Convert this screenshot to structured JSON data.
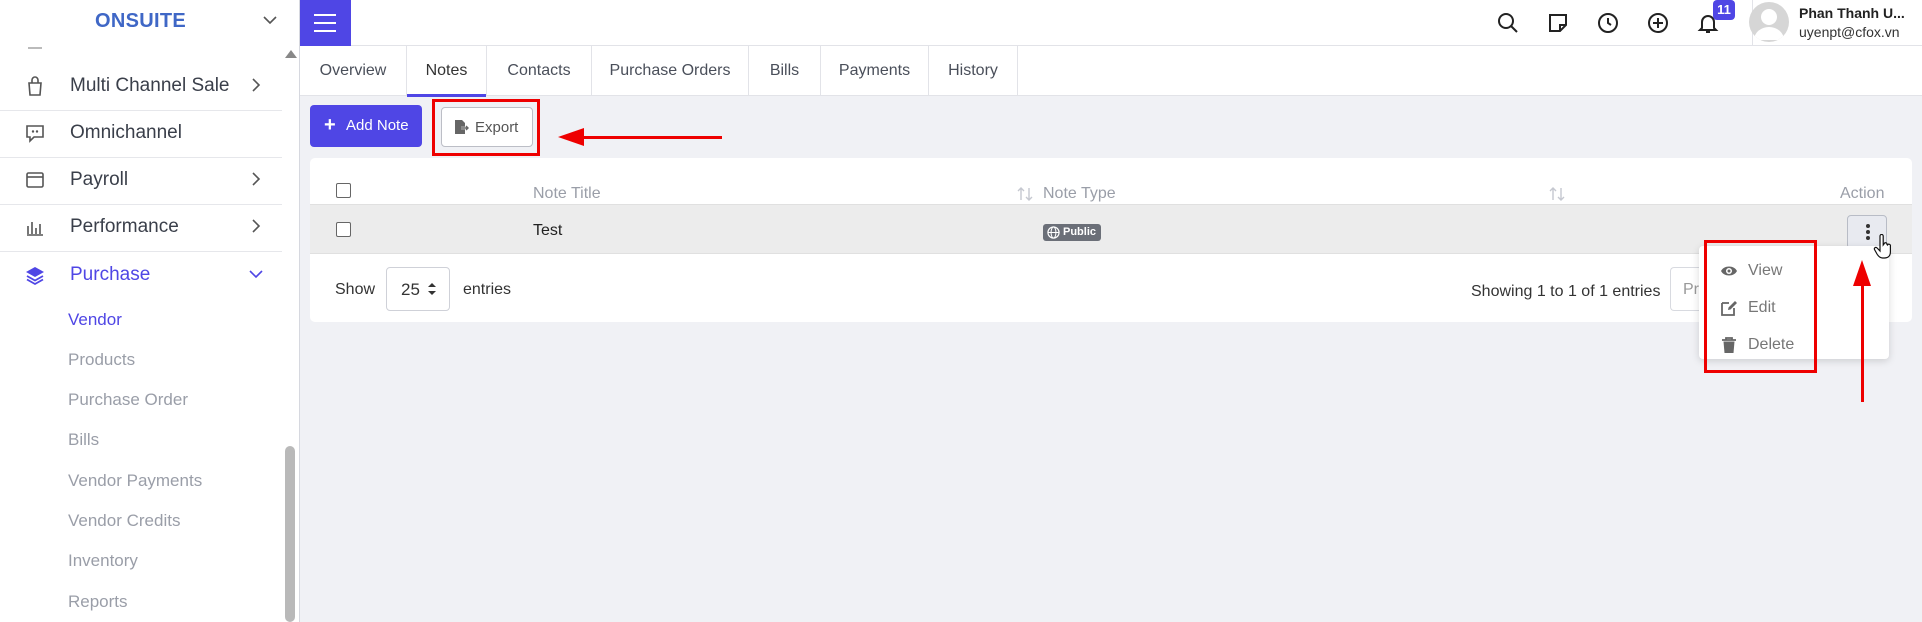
{
  "sidebar": {
    "brand": "ONSUITE",
    "items": [
      {
        "label": "Multi Channel Sale",
        "icon": "bag-icon",
        "has_chevron": true
      },
      {
        "label": "Omnichannel",
        "icon": "chat-icon",
        "has_chevron": false
      },
      {
        "label": "Payroll",
        "icon": "wallet-icon",
        "has_chevron": true
      },
      {
        "label": "Performance",
        "icon": "bar-chart-icon",
        "has_chevron": true
      },
      {
        "label": "Purchase",
        "icon": "layers-icon",
        "has_chevron": true,
        "expanded": true
      }
    ],
    "sub_items": [
      "Vendor",
      "Products",
      "Purchase Order",
      "Bills",
      "Vendor Payments",
      "Vendor Credits",
      "Inventory",
      "Reports"
    ],
    "active_sub_item": "Vendor"
  },
  "topbar": {
    "icons": [
      "search-icon",
      "note-icon",
      "clock-icon",
      "plus-circle-icon",
      "bell-icon"
    ],
    "notification_count": "11",
    "user_name": "Phan Thanh U...",
    "user_email": "uyenpt@cfox.vn"
  },
  "tabs": [
    "Overview",
    "Notes",
    "Contacts",
    "Purchase Orders",
    "Bills",
    "Payments",
    "History"
  ],
  "active_tab": "Notes",
  "toolbar": {
    "add_label": "Add Note",
    "export_label": "Export"
  },
  "table": {
    "columns": [
      "Note Title",
      "Note Type",
      "Action"
    ],
    "rows": [
      {
        "title": "Test",
        "type": "Public"
      }
    ]
  },
  "footer": {
    "show_label": "Show",
    "page_size": "25",
    "entries_label": "entries",
    "showing_text": "Showing 1 to 1 of 1 entries",
    "prev_label": "Previous"
  },
  "action_menu": [
    {
      "label": "View",
      "icon": "eye-icon"
    },
    {
      "label": "Edit",
      "icon": "edit-icon"
    },
    {
      "label": "Delete",
      "icon": "trash-icon"
    }
  ],
  "colors": {
    "accent": "#4f46e5",
    "brand": "#3f67c6",
    "annotation": "#e00000"
  }
}
